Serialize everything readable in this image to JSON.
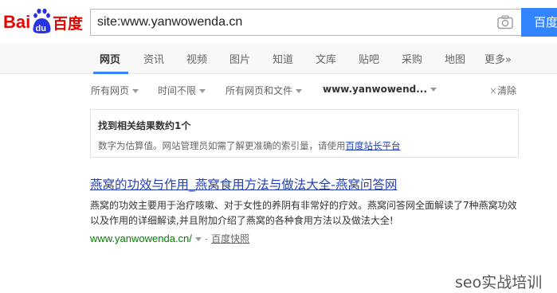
{
  "brand": {
    "logo_text_left": "Bai",
    "logo_text_paw": "du",
    "logo_text_right": "百度",
    "logo_red": "#e10602",
    "logo_blue": "#2932e1"
  },
  "search": {
    "query": "site:www.yanwowenda.cn",
    "button_label": "百度",
    "accent": "#3385ff"
  },
  "tabs": [
    {
      "label": "网页",
      "active": true
    },
    {
      "label": "资讯"
    },
    {
      "label": "视频"
    },
    {
      "label": "图片"
    },
    {
      "label": "知道"
    },
    {
      "label": "文库"
    },
    {
      "label": "贴吧"
    },
    {
      "label": "采购"
    },
    {
      "label": "地图"
    },
    {
      "label": "更多»"
    }
  ],
  "filters": {
    "items": [
      "所有网页",
      "时间不限",
      "所有网页和文件",
      "www.yanwowend..."
    ],
    "clear_label": "清除"
  },
  "info": {
    "title": "找到相关结果数约1个",
    "desc_prefix": "数字为估算值。网站管理员如需了解更准确的索引量，请使用",
    "link_label": "百度站长平台"
  },
  "result": {
    "title": "燕窝的功效与作用_燕窝食用方法与做法大全-燕窝问答网",
    "abstract": "燕窝的功效主要用于治疗咳嗽、对于女性的养阴有非常好的疗效。燕窝问答网全面解读了7种燕窝功效以及作用的详细解读,并且附加介绍了燕窝的各种食用方法以及做法大全!",
    "url": "www.yanwowenda.cn/",
    "dash": "-",
    "snapshot_label": "百度快照",
    "title_color": "#2440b3",
    "url_color": "#008000"
  },
  "watermark": "seo实战培训"
}
